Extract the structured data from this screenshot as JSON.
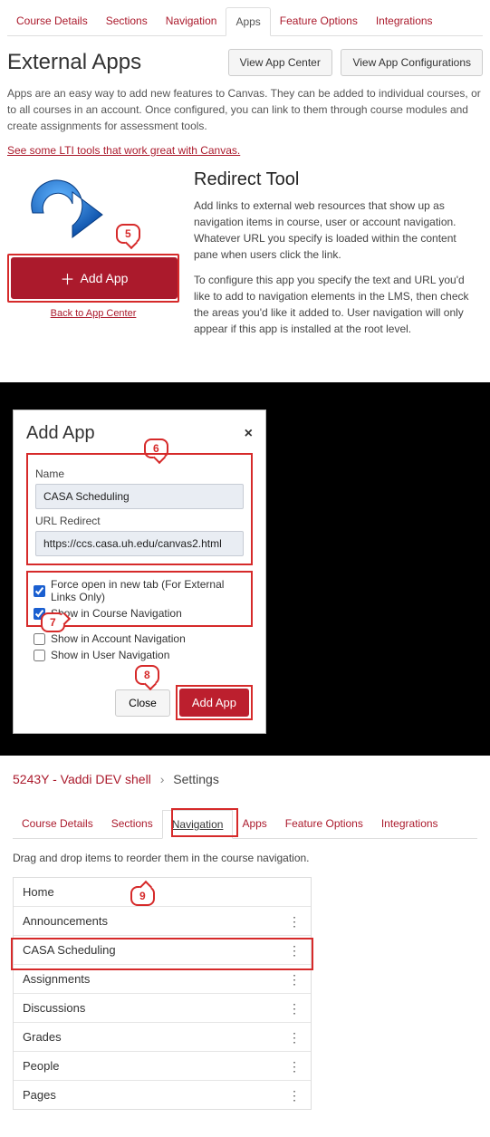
{
  "panel1": {
    "tabs": [
      "Course Details",
      "Sections",
      "Navigation",
      "Apps",
      "Feature Options",
      "Integrations"
    ],
    "activeTab": "Apps",
    "title": "External Apps",
    "btnViewCenter": "View App Center",
    "btnViewConfigs": "View App Configurations",
    "intro": "Apps are an easy way to add new features to Canvas. They can be added to individual courses, or to all courses in an account. Once configured, you can link to them through course modules and create assignments for assessment tools.",
    "ltiLink": "See some LTI tools that work great with Canvas.",
    "addAppBtn": "Add App",
    "backLink": "Back to App Center",
    "toolTitle": "Redirect Tool",
    "para1": "Add links to external web resources that show up as navigation items in course, user or account navigation. Whatever URL you specify is loaded within the content pane when users click the link.",
    "para2": "To configure this app you specify the text and URL you'd like to add to navigation elements in the LMS, then check the areas you'd like it added to. User navigation will only appear if this app is installed at the root level.",
    "callout5": "5"
  },
  "dialog": {
    "title": "Add App",
    "nameLabel": "Name",
    "nameValue": "CASA Scheduling",
    "urlLabel": "URL Redirect",
    "urlValue": "https://ccs.casa.uh.edu/canvas2.html",
    "chkForceLabel": "Force open in new tab (For External Links Only)",
    "chkForceChecked": true,
    "chkCourseLabel": "Show in Course Navigation",
    "chkCourseChecked": true,
    "chkAccountLabel": "Show in Account Navigation",
    "chkAccountChecked": false,
    "chkUserLabel": "Show in User Navigation",
    "chkUserChecked": false,
    "closeBtn": "Close",
    "addBtn": "Add App",
    "callout6": "6",
    "callout7": "7",
    "callout8": "8"
  },
  "panel3": {
    "crumbCourse": "5243Y - Vaddi DEV shell",
    "crumbPage": "Settings",
    "tabs": [
      "Course Details",
      "Sections",
      "Navigation",
      "Apps",
      "Feature Options",
      "Integrations"
    ],
    "activeTab": "Navigation",
    "hint": "Drag and drop items to reorder them in the course navigation.",
    "navItems": [
      "Home",
      "Announcements",
      "CASA Scheduling",
      "Assignments",
      "Discussions",
      "Grades",
      "People",
      "Pages"
    ],
    "highlightItem": "CASA Scheduling",
    "callout9": "9"
  }
}
